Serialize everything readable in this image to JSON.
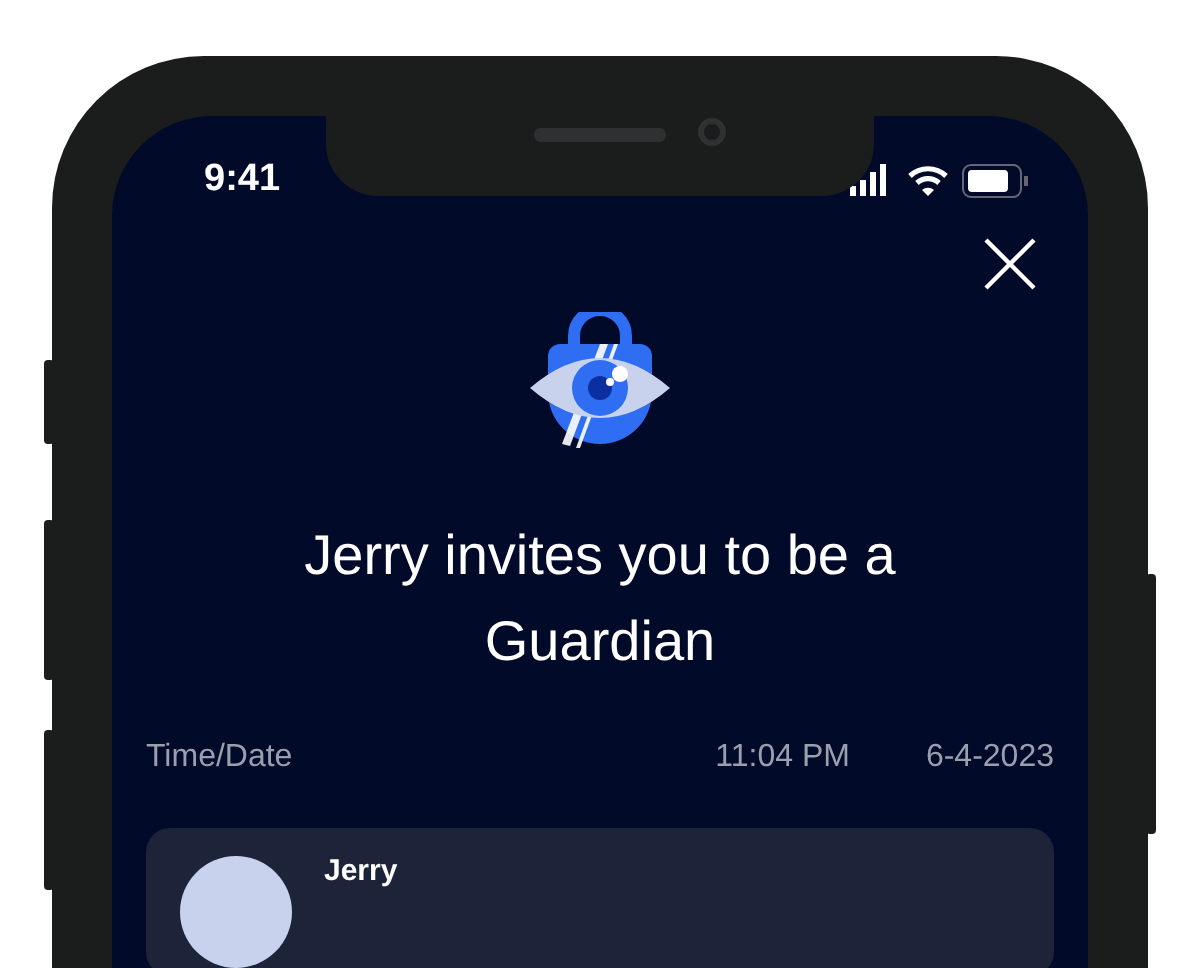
{
  "status_bar": {
    "time": "9:41"
  },
  "title": "Jerry invites you to be a Guardian",
  "details": {
    "label": "Time/Date",
    "time": "11:04 PM",
    "date": "6-4-2023"
  },
  "inviter": {
    "name": "Jerry"
  }
}
